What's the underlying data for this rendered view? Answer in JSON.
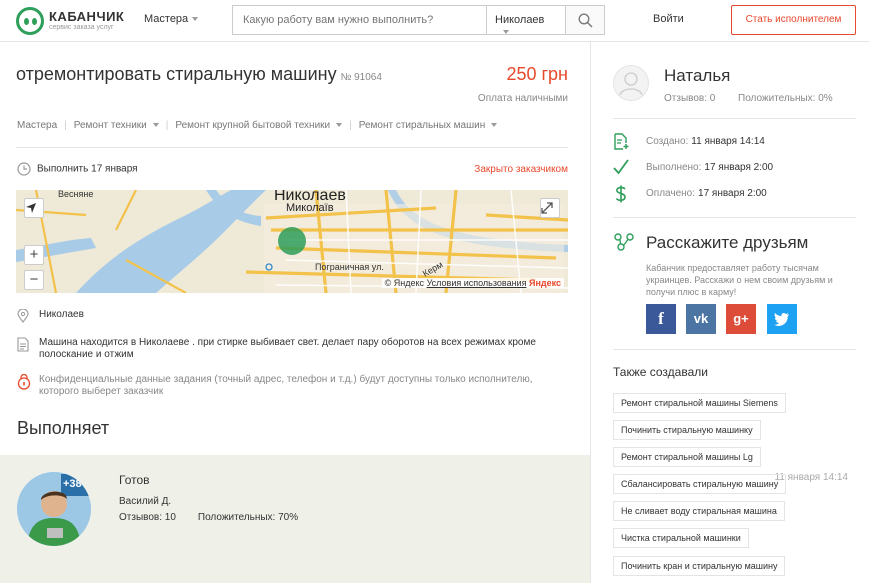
{
  "header": {
    "brand": "КАБАНЧИК",
    "tagline": "сервис заказа услуг",
    "masters_label": "Мастера",
    "search_placeholder": "Какую работу вам нужно выполнить?",
    "city": "Николаев",
    "login_label": "Войти",
    "become_label": "Стать исполнителем"
  },
  "task": {
    "title": "отремонтировать стиральную машину",
    "number": "№ 91064",
    "price": "250 грн",
    "payment": "Оплата наличными",
    "breadcrumbs": [
      "Мастера",
      "Ремонт техники",
      "Ремонт крупной бытовой техники",
      "Ремонт стиральных машин"
    ],
    "do_date": "Выполнить 17 января",
    "closed_label": "Закрыто заказчиком",
    "location": "Николаев",
    "description": "Машина находится в Николаеве . при стирке выбивает свет. делает пару оборотов на всех режимах кроме полоскание и отжим",
    "privacy_note": "Конфиденциальные данные задания (точный адрес, телефон и т.д.) будут доступны только исполнителю, которого выберет заказчик"
  },
  "map": {
    "city_ru": "Николаев",
    "city_ua": "Миколаїв",
    "label_vesnyane": "Весняне",
    "label_street": "Пограничная ул.",
    "label_ker": "Керм",
    "copyright_prefix": "© Яндекс",
    "terms_link": "Условия использования",
    "yandex_logo": "Яндекс",
    "zoom_in": "+",
    "zoom_out": "−",
    "colors": {
      "land": "#efe9d7",
      "water": "#a8cbe8",
      "road": "#f2c24a",
      "marker": "#2e9e5b"
    }
  },
  "performer": {
    "section_title": "Выполняет",
    "status": "Готов",
    "date": "11 января 14:14",
    "name": "Василий Д.",
    "reviews": "Отзывов: 10",
    "positive": "Положительных: 70%",
    "avatar_text": "+38"
  },
  "customer": {
    "name": "Наталья",
    "reviews": "Отзывов: 0",
    "positive": "Положительных: 0%"
  },
  "timeline": [
    {
      "label": "Создано:",
      "value": "11 января 14:14",
      "icon": "document-plus-icon"
    },
    {
      "label": "Выполнено:",
      "value": "17 января 2:00",
      "icon": "checkmark-icon"
    },
    {
      "label": "Оплачено:",
      "value": "17 января 2:00",
      "icon": "dollar-icon"
    }
  ],
  "share": {
    "title": "Расскажите друзьям",
    "text": "Кабанчик предоставляет работу тысячам украинцев. Расскажи о нем своим друзьям и получи плюс в карму!",
    "buttons": [
      {
        "label": "f",
        "color": "#3b5998",
        "name": "facebook"
      },
      {
        "label": "vk",
        "color": "#4c75a3",
        "name": "vk"
      },
      {
        "label": "g+",
        "color": "#dd4b39",
        "name": "google-plus"
      },
      {
        "label": "t",
        "color": "#1da1f2",
        "name": "twitter"
      }
    ]
  },
  "also": {
    "title": "Также создавали",
    "tags": [
      "Ремонт стиральной машины Siemens",
      "Починить стиральную машинку",
      "Ремонт стиральной машины Lg",
      "Сбалансировать стиральную машину",
      "Не сливает воду стиральная машина",
      "Чистка стиральной машинки",
      "Починить кран и стиральную машину"
    ]
  },
  "colors": {
    "accent": "#e8482c",
    "brand": "#2e9e5b"
  }
}
